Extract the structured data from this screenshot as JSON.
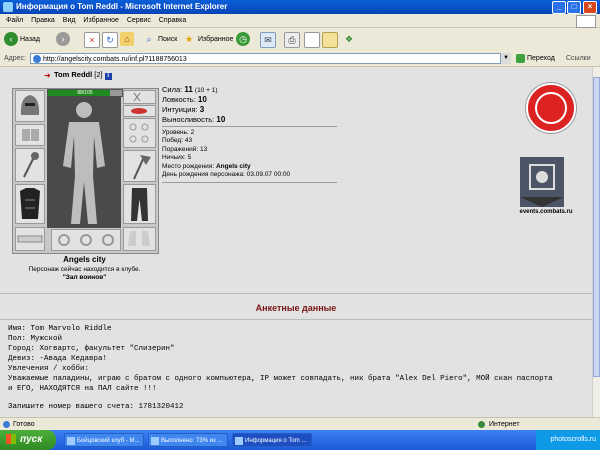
{
  "window": {
    "title": "Информация о Tom Reddl - Microsoft Internet Explorer"
  },
  "menu": [
    "Файл",
    "Правка",
    "Вид",
    "Избранное",
    "Сервис",
    "Справка"
  ],
  "toolbar": {
    "back": "Назад",
    "search": "Поиск",
    "favorites": "Избранное"
  },
  "address": {
    "label": "Адрес:",
    "url": "http://angelscity.combats.ru/inf.pl?1188756013",
    "go": "Переход",
    "links": "Ссылки"
  },
  "character": {
    "name": "Tom Reddl",
    "level": "[2]",
    "hp": "88/105",
    "hp_fraction": 0.84,
    "stats": [
      {
        "label": "Сила:",
        "value": "11",
        "extra": "(10 + 1)"
      },
      {
        "label": "Ловкость:",
        "value": "10",
        "extra": ""
      },
      {
        "label": "Интуиция:",
        "value": "3",
        "extra": ""
      },
      {
        "label": "Выносливость:",
        "value": "10",
        "extra": ""
      }
    ],
    "info": [
      {
        "label": "Уровень:",
        "value": "2"
      },
      {
        "label": "Побед:",
        "value": "43"
      },
      {
        "label": "Поражений:",
        "value": "13"
      },
      {
        "label": "Ничьих:",
        "value": "5"
      },
      {
        "label": "Место рождения:",
        "value": "Angels city"
      },
      {
        "label": "День рождения персонажа:",
        "value": "03.09.07 00:00"
      }
    ],
    "city": "Angels city",
    "location_note": "Персонаж сейчас находится в клубе.",
    "location_room": "\"Зал воинов\""
  },
  "sidebar": {
    "events_label": "events.combats.ru"
  },
  "profile": {
    "heading": "Анкетные данные",
    "lines": [
      "Имя: Tom Marvolo Riddle",
      "Пол: Мужской",
      "Город: Хогвартс, факультет \"Слизерин\"",
      "Девиз: -Авада Кедавра!",
      "Увлечения / хобби:",
      "Уважаемые паладины, играю с братом с одного компьютера, IP может совпадать, ник брата \"Alex Del Piero\", МОЙ скан паспорта",
      "и ЕГО, НАХОДЯТСЯ на ПАЛ сайте !!!",
      "",
      "Запишите номер вашего счета: 1781320412"
    ]
  },
  "status": {
    "left": "Готово",
    "right": "Интернет"
  },
  "taskbar": {
    "start": "пуск",
    "tasks": [
      "Бойцовский клуб - M...",
      "Выполнено: 73% из ...",
      "Информация о Tom ..."
    ],
    "tray_text": "photoscrolls.ru"
  }
}
